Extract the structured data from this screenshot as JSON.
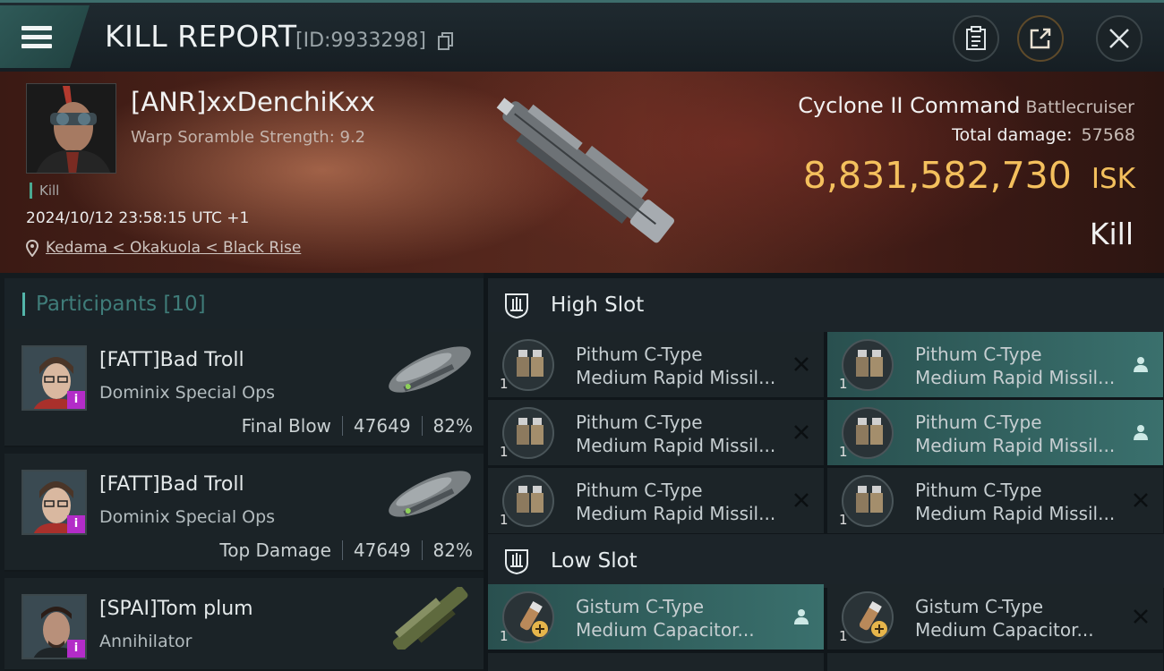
{
  "header": {
    "title": "KILL REPORT",
    "report_id": "[ID:9933298]"
  },
  "victim": {
    "name": "[ANR]xxDenchiKxx",
    "warp_scramble": "Warp Soramble Strength: 9.2",
    "tag": "Kill",
    "datetime": "2024/10/12 23:58:15 UTC +1",
    "location": "Kedama < Okakuola < Black Rise"
  },
  "ship": {
    "name": "Cyclone II Command",
    "class": "Battlecruiser",
    "total_damage_label": "Total damage:",
    "total_damage": "57568",
    "isk_value": "8,831,582,730",
    "isk_unit": "ISK",
    "result": "Kill"
  },
  "participants": {
    "label": "Participants [10]",
    "rows": [
      {
        "name": "[FATT]Bad Troll",
        "ship": "Dominix Special Ops",
        "role": "Final Blow",
        "damage": "47649",
        "percent": "82%"
      },
      {
        "name": "[FATT]Bad Troll",
        "ship": "Dominix Special Ops",
        "role": "Top Damage",
        "damage": "47649",
        "percent": "82%"
      },
      {
        "name": "[SPAI]Tom plum",
        "ship": "Annihilator"
      }
    ]
  },
  "high_slot": {
    "label": "High Slot",
    "modules": [
      {
        "line1": "Pithum C-Type",
        "line2": "Medium Rapid Missil...",
        "qty": "1",
        "action": "x-icon"
      },
      {
        "line1": "Pithum C-Type",
        "line2": "Medium Rapid Missil...",
        "qty": "1",
        "action": "person-icon"
      },
      {
        "line1": "Pithum C-Type",
        "line2": "Medium Rapid Missil...",
        "qty": "1",
        "action": "x-icon"
      },
      {
        "line1": "Pithum C-Type",
        "line2": "Medium Rapid Missil...",
        "qty": "1",
        "action": "person-icon"
      },
      {
        "line1": "Pithum C-Type",
        "line2": "Medium Rapid Missil...",
        "qty": "1",
        "action": "x-icon"
      },
      {
        "line1": "Pithum C-Type",
        "line2": "Medium Rapid Missil...",
        "qty": "1",
        "action": "x-icon"
      }
    ]
  },
  "low_slot": {
    "label": "Low Slot",
    "modules": [
      {
        "line1": "Gistum C-Type",
        "line2": "Medium Capacitor...",
        "qty": "1",
        "action": "person-icon"
      },
      {
        "line1": "Gistum C-Type",
        "line2": "Medium Capacitor...",
        "qty": "1",
        "action": "x-icon"
      }
    ]
  },
  "colors": {
    "accent": "#4aa890",
    "isk": "#f4c05d",
    "highlight": "#3a706d",
    "badge": "#b32cc8"
  }
}
